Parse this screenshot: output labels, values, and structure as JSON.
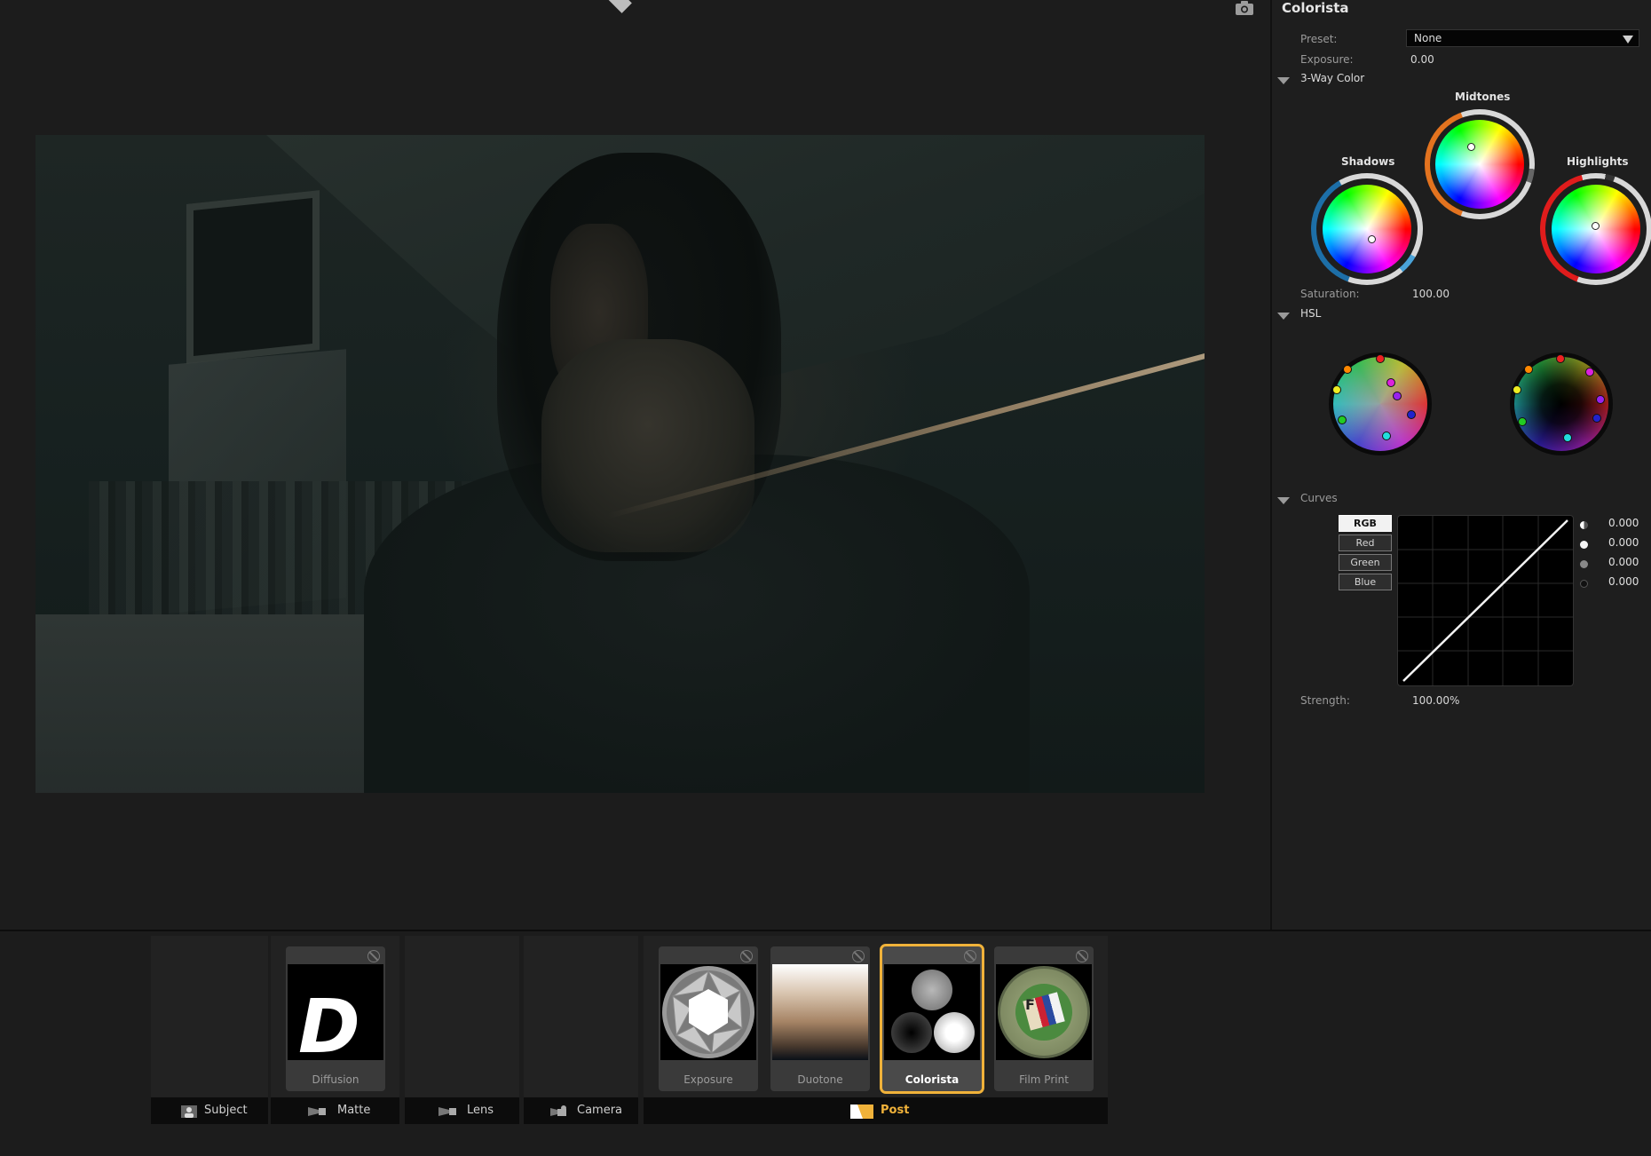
{
  "viewer": {
    "camera_icon": "camera-icon"
  },
  "panel": {
    "title": "Colorista",
    "preset_label": "Preset:",
    "preset_value": "None",
    "exposure_label": "Exposure:",
    "exposure_value": "0.00",
    "three_way_label": "3-Way Color",
    "wheels": {
      "shadows": "Shadows",
      "midtones": "Midtones",
      "highlights": "Highlights"
    },
    "saturation_label": "Saturation:",
    "saturation_value": "100.00",
    "hsl_label": "HSL",
    "curves_label": "Curves",
    "curve_tabs": [
      "RGB",
      "Red",
      "Green",
      "Blue"
    ],
    "curve_values": [
      "0.000",
      "0.000",
      "0.000",
      "0.000"
    ],
    "strength_label": "Strength:",
    "strength_value": "100.00%"
  },
  "bottom": {
    "slots": {
      "subject": "Subject",
      "matte": "Matte",
      "lens": "Lens",
      "camera": "Camera",
      "post": "Post"
    },
    "cards": {
      "diffusion": "Diffusion",
      "diffusion_letter": "D",
      "exposure": "Exposure",
      "duotone": "Duotone",
      "colorista": "Colorista",
      "film_print": "Film Print",
      "film_print_letter": "F"
    },
    "accent_color": "#f0b23a"
  }
}
